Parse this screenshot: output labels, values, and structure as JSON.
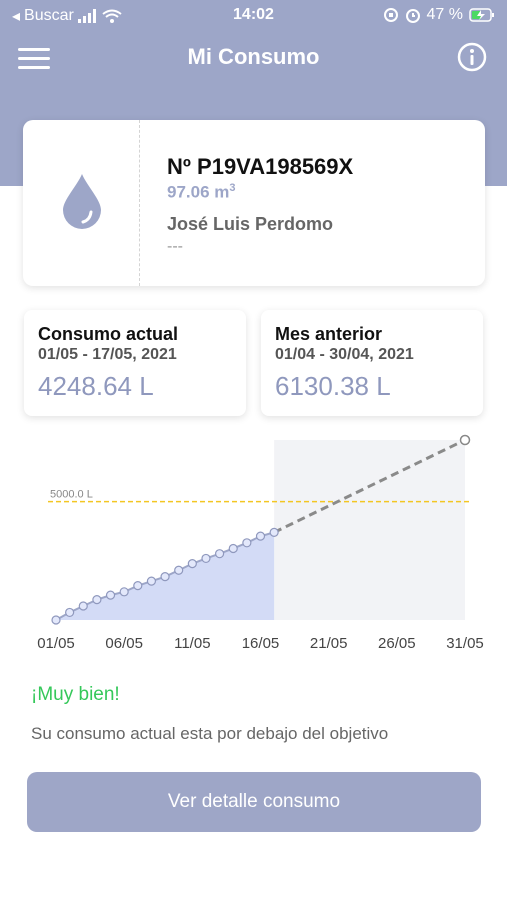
{
  "status_bar": {
    "carrier": "Buscar",
    "time": "14:02",
    "battery": "47 %"
  },
  "header": {
    "title": "Mi Consumo",
    "menu_icon": "hamburger-icon",
    "info_icon": "info-icon"
  },
  "meter": {
    "id": "Nº P19VA198569X",
    "volume": "97.06 m",
    "volume_unit_exp": "3",
    "owner": "José Luis Perdomo",
    "extra": "---",
    "icon": "water-drop-icon"
  },
  "stats": {
    "current": {
      "title": "Consumo actual",
      "range": "01/05 - 17/05, 2021",
      "value": "4248.64 L"
    },
    "previous": {
      "title": "Mes anterior",
      "range": "01/04 - 30/04, 2021",
      "value": "6130.38 L"
    }
  },
  "chart_data": {
    "type": "line",
    "x_tick_labels": [
      "01/05",
      "06/05",
      "11/05",
      "16/05",
      "21/05",
      "26/05",
      "31/05"
    ],
    "target": {
      "label": "5000.0 L",
      "value": 5000
    },
    "series": [
      {
        "kind": "actual",
        "x": [
          1,
          2,
          3,
          4,
          5,
          6,
          7,
          8,
          9,
          10,
          11,
          12,
          13,
          14,
          15,
          16,
          17
        ],
        "y": [
          0,
          320,
          590,
          860,
          1050,
          1190,
          1450,
          1640,
          1830,
          2100,
          2380,
          2600,
          2800,
          3020,
          3260,
          3540,
          3700
        ]
      },
      {
        "kind": "projection",
        "x": [
          17,
          31
        ],
        "y": [
          3700,
          7600
        ]
      }
    ],
    "ylim": [
      0,
      7600
    ],
    "xlim": [
      1,
      31
    ]
  },
  "message": {
    "headline": "¡Muy bien!",
    "description": "Su consumo actual esta por debajo del objetivo"
  },
  "actions": {
    "detail_button": "Ver detalle consumo"
  },
  "colors": {
    "primary": "#9da6c8",
    "good": "#35c85a",
    "target_line": "#f3c623"
  }
}
